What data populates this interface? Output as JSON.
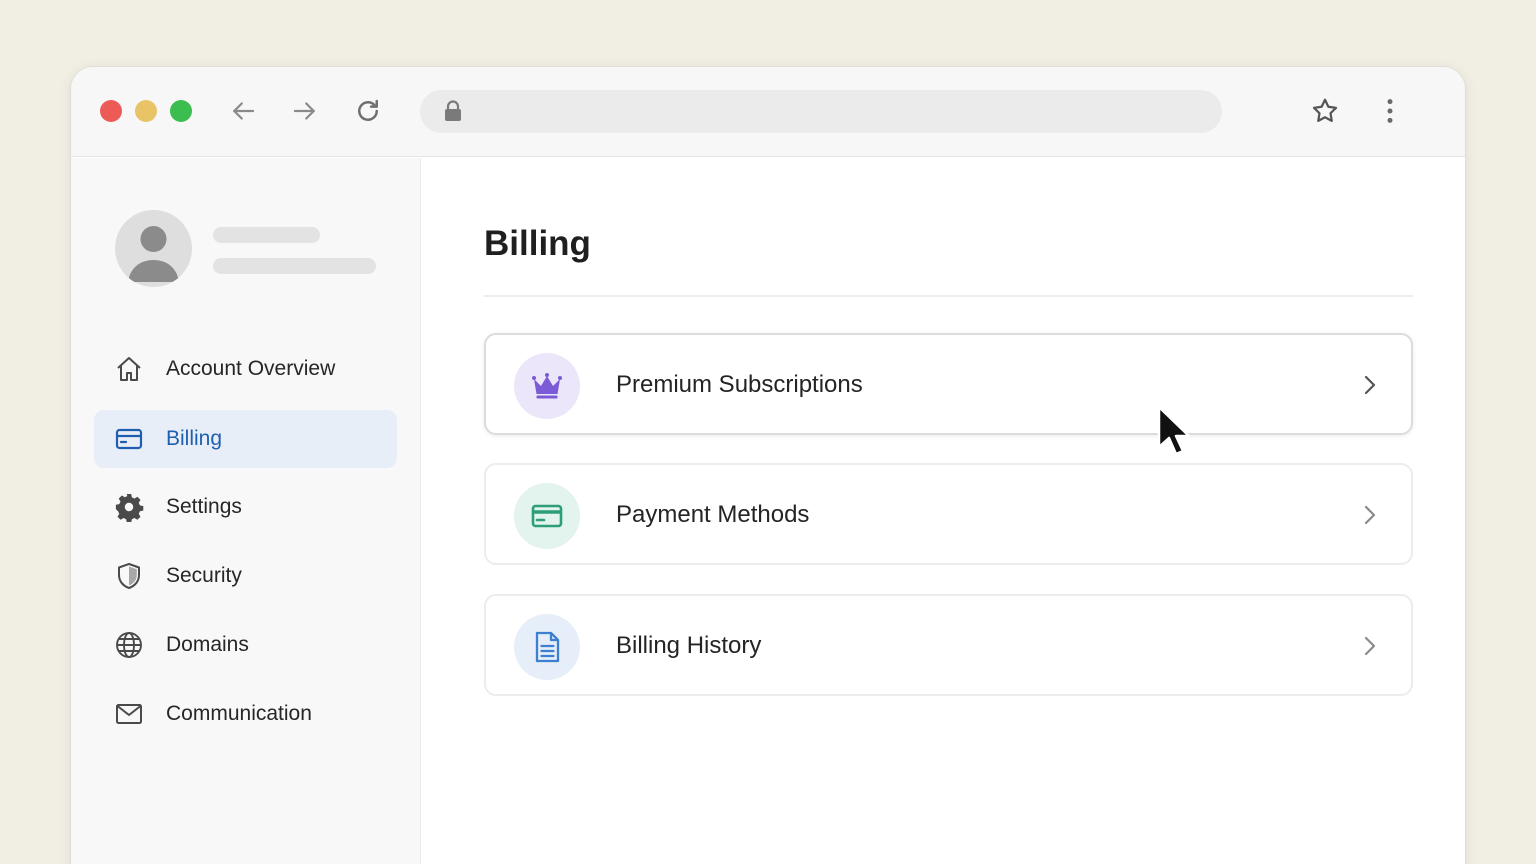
{
  "colors": {
    "accent_blue": "#1f5fb0",
    "active_nav_bg": "#e8eef7",
    "crown_purple": "#7b5bd6",
    "card_green": "#2e9e7a",
    "doc_blue": "#3f7fd0"
  },
  "browser": {
    "icons": [
      "arrow-left-icon",
      "arrow-right-icon",
      "reload-icon",
      "lock-icon",
      "star-icon",
      "kebab-menu-icon"
    ]
  },
  "sidebar": {
    "items": [
      {
        "label": "Account Overview",
        "icon": "home-icon"
      },
      {
        "label": "Billing",
        "icon": "credit-card-icon",
        "active": true
      },
      {
        "label": "Settings",
        "icon": "gear-icon"
      },
      {
        "label": "Security",
        "icon": "shield-icon"
      },
      {
        "label": "Domains",
        "icon": "globe-icon"
      },
      {
        "label": "Communication",
        "icon": "mail-icon"
      }
    ]
  },
  "main": {
    "title": "Billing",
    "cards": [
      {
        "label": "Premium Subscriptions",
        "icon": "crown-icon"
      },
      {
        "label": "Payment Methods",
        "icon": "credit-card-icon"
      },
      {
        "label": "Billing History",
        "icon": "document-icon"
      }
    ]
  }
}
